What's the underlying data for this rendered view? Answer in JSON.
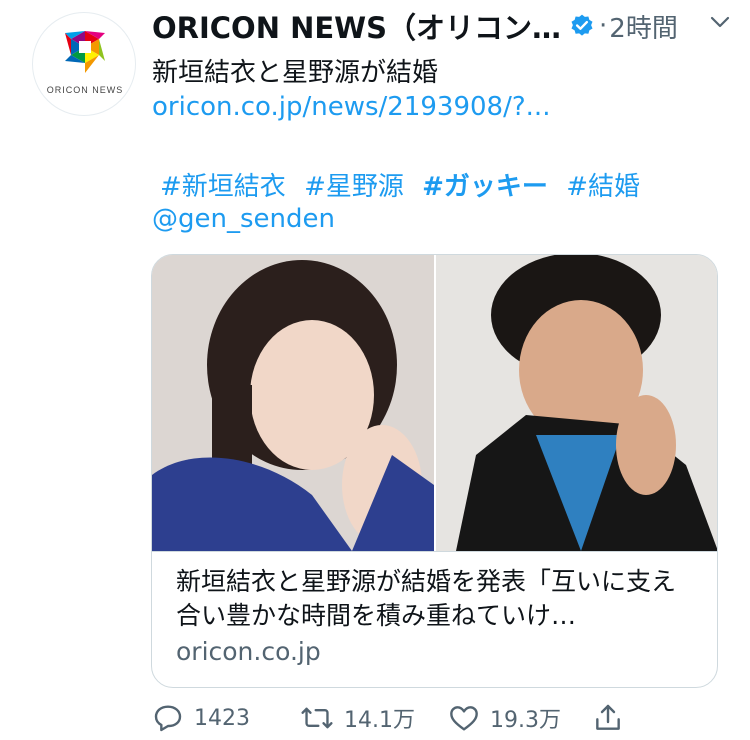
{
  "account": {
    "display_name": "ORICON NEWS（オリコン…",
    "time": "2時間",
    "avatar_text": "ORICON NEWS"
  },
  "tweet": {
    "line1": "新垣結衣と星野源が結婚",
    "link": "oricon.co.jp/news/2193908/?...",
    "hashtags": [
      "#新垣結衣",
      "#星野源",
      "#ガッキー",
      "#結婚"
    ],
    "mention": "@gen_senden"
  },
  "card": {
    "title": "新垣結衣と星野源が結婚を発表「互いに支え合い豊かな時間を積み重ねていけ…",
    "domain": "oricon.co.jp"
  },
  "actions": {
    "reply_count": "1423",
    "retweet_count": "14.1万",
    "like_count": "19.3万"
  },
  "colors": {
    "link": "#1d9bf0",
    "secondary_text": "#536471",
    "border": "#cfd9de"
  },
  "icons": [
    "verified-badge-icon",
    "caret-down-icon",
    "reply-icon",
    "retweet-icon",
    "like-icon",
    "share-icon"
  ]
}
